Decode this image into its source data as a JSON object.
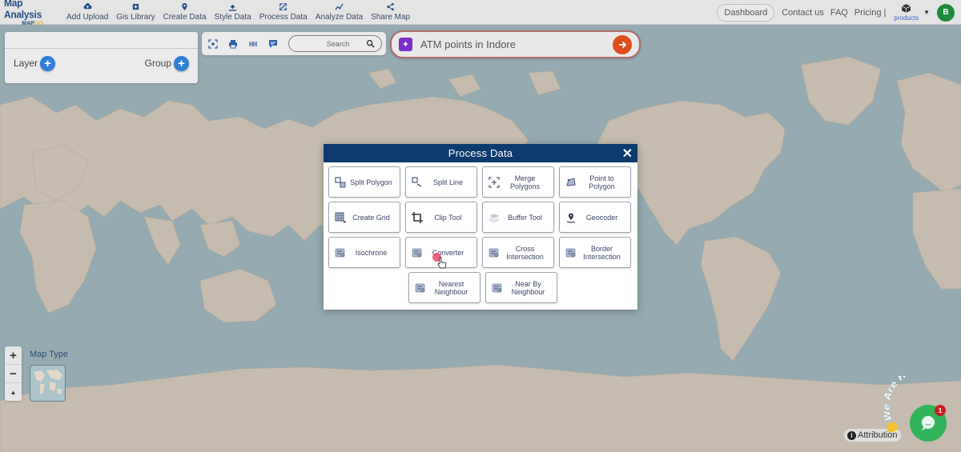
{
  "brand": {
    "title": "Map Analysis",
    "subtitle_prefix": "MAP",
    "subtitle_suffix": "GO"
  },
  "nav": {
    "items": [
      {
        "label": "Add Upload",
        "icon": "cloud-upload-icon"
      },
      {
        "label": "Gis Library",
        "icon": "library-icon"
      },
      {
        "label": "Create Data",
        "icon": "map-pin-icon"
      },
      {
        "label": "Style Data",
        "icon": "paint-bucket-icon"
      },
      {
        "label": "Process Data",
        "icon": "process-icon"
      },
      {
        "label": "Analyze Data",
        "icon": "analyze-icon"
      },
      {
        "label": "Share Map",
        "icon": "share-icon"
      }
    ]
  },
  "top_right": {
    "dashboard": "Dashboard",
    "contact": "Contact us",
    "faq": "FAQ",
    "pricing": "Pricing |",
    "products": "products",
    "avatar_initial": "B"
  },
  "layer_panel": {
    "layer_label": "Layer",
    "group_label": "Group"
  },
  "toolbar": {
    "search_placeholder": "Search"
  },
  "ai_prompt": {
    "value": "ATM points in Indore"
  },
  "modal": {
    "title": "Process Data",
    "tools": [
      {
        "label": "Split Polygon",
        "icon": "split-polygon-icon"
      },
      {
        "label": "Split Line",
        "icon": "split-line-icon"
      },
      {
        "label": "Merge Polygons",
        "icon": "merge-polygons-icon"
      },
      {
        "label": "Point to Polygon",
        "icon": "point-to-polygon-icon"
      },
      {
        "label": "Create Grid",
        "icon": "create-grid-icon"
      },
      {
        "label": "Clip Tool",
        "icon": "crop-icon"
      },
      {
        "label": "Buffer Tool",
        "icon": "buffer-layers-icon"
      },
      {
        "label": "Geocoder",
        "icon": "geocoder-pin-icon"
      },
      {
        "label": "Isochrone",
        "icon": "isochrone-icon"
      },
      {
        "label": "Converter",
        "icon": "converter-icon"
      },
      {
        "label": "Cross Intersection",
        "icon": "cross-intersection-icon"
      },
      {
        "label": "Border Intersection",
        "icon": "border-intersection-icon"
      },
      {
        "label": "Nearest Neighbour",
        "icon": "nearest-neighbour-icon"
      },
      {
        "label": "Near By Neighbour",
        "icon": "near-by-neighbour-icon"
      }
    ]
  },
  "map_controls": {
    "zoom_in": "+",
    "zoom_out": "−",
    "compass": "▲",
    "map_type_label": "Map Type"
  },
  "attribution": {
    "label": "Attribution"
  },
  "chat": {
    "tagline": "We Are Here!",
    "badge_count": "1"
  },
  "colors": {
    "brand": "#244f87",
    "modal_header": "#0d3b6e",
    "ai_go": "#dd4e1c",
    "chat": "#33b45a",
    "avatar": "#1e8a3a"
  }
}
